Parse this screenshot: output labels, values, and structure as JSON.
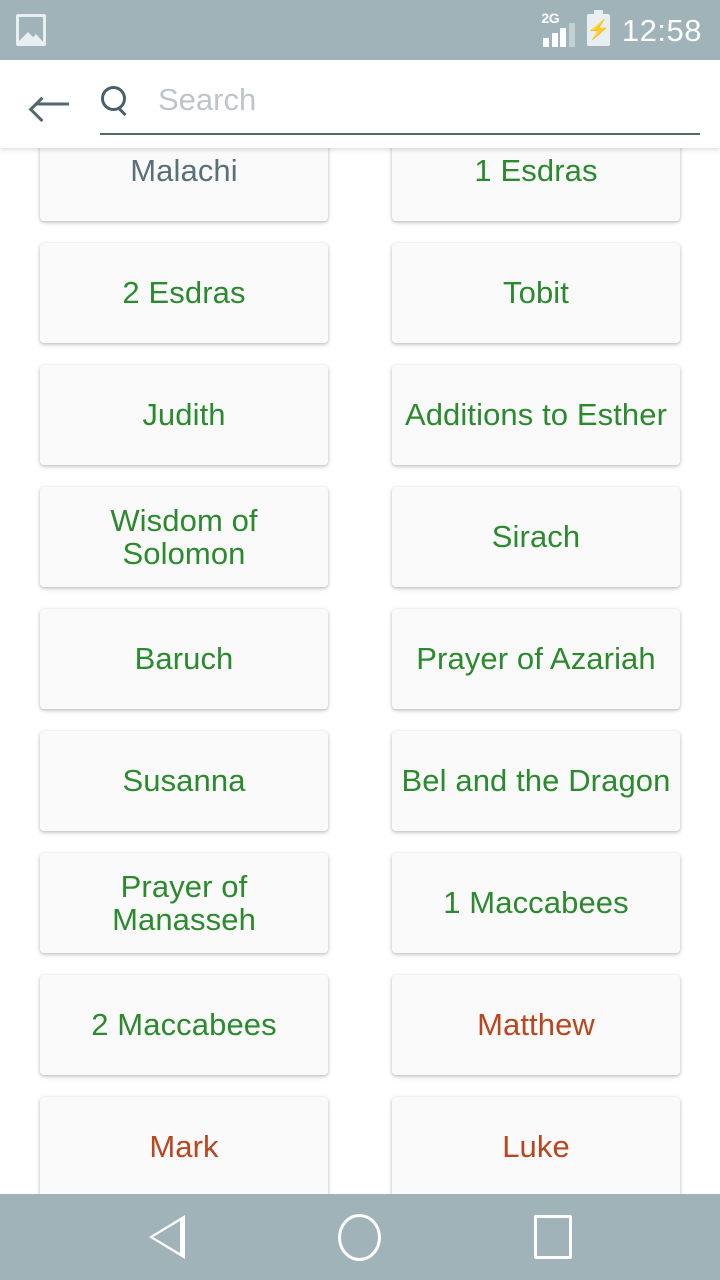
{
  "status_bar": {
    "notification_icon": "photo-icon",
    "network_type": "2G",
    "signal_icon": "signal-bars-icon",
    "battery_icon": "battery-charging-icon",
    "time": "12:58",
    "background_color": "#9fb3b8"
  },
  "header": {
    "back_icon": "back-arrow-icon",
    "search_icon": "search-icon",
    "search_value": "",
    "search_placeholder": "Search"
  },
  "colors": {
    "green": "#2b8a2e",
    "red": "#b9461f",
    "slate": "#5a7078",
    "card_bg": "#fafafa",
    "page_bg": "#ffffff"
  },
  "books": [
    {
      "label": "Malachi",
      "color": "slate"
    },
    {
      "label": "1 Esdras",
      "color": "green"
    },
    {
      "label": "2 Esdras",
      "color": "green"
    },
    {
      "label": "Tobit",
      "color": "green"
    },
    {
      "label": "Judith",
      "color": "green"
    },
    {
      "label": "Additions to Esther",
      "color": "green"
    },
    {
      "label": "Wisdom of Solomon",
      "color": "green"
    },
    {
      "label": "Sirach",
      "color": "green"
    },
    {
      "label": "Baruch",
      "color": "green"
    },
    {
      "label": "Prayer of Azariah",
      "color": "green"
    },
    {
      "label": "Susanna",
      "color": "green"
    },
    {
      "label": "Bel and the Dragon",
      "color": "green"
    },
    {
      "label": "Prayer of Manasseh",
      "color": "green"
    },
    {
      "label": "1 Maccabees",
      "color": "green"
    },
    {
      "label": "2 Maccabees",
      "color": "green"
    },
    {
      "label": "Matthew",
      "color": "red"
    },
    {
      "label": "Mark",
      "color": "red"
    },
    {
      "label": "Luke",
      "color": "red"
    }
  ],
  "nav_bar": {
    "back_icon": "nav-back-triangle-icon",
    "home_icon": "nav-home-circle-icon",
    "recents_icon": "nav-recents-square-icon",
    "background_color": "#9fb3b8"
  }
}
